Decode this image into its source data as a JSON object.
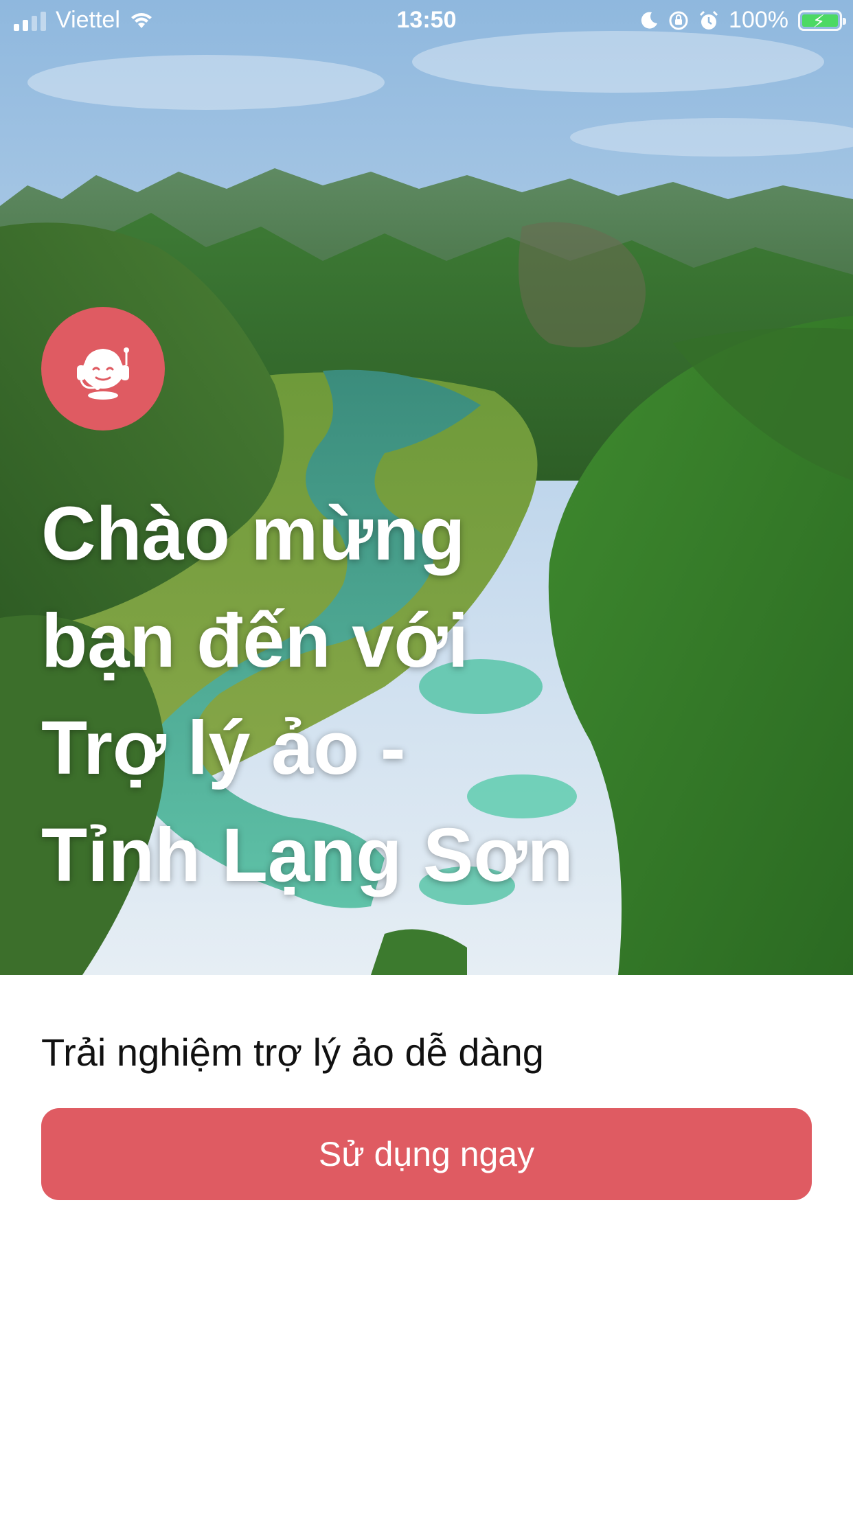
{
  "status_bar": {
    "carrier": "Viettel",
    "time": "13:50",
    "battery_percent": "100%",
    "signal_icon": "cellular-signal-icon",
    "wifi_icon": "wifi-icon",
    "icons": [
      "moon-icon",
      "orientation-lock-icon",
      "alarm-icon",
      "battery-charging-icon"
    ],
    "battery_level": 1.0
  },
  "hero": {
    "bot_icon": "support-bot-icon",
    "title_lines": [
      "Chào mừng",
      "bạn đến với",
      "Trợ lý ảo -",
      "Tỉnh Lạng Sơn"
    ]
  },
  "main": {
    "subtitle": "Trải nghiệm trợ lý ảo dễ dàng",
    "cta_label": "Sử dụng ngay"
  },
  "colors": {
    "accent": "#df5b62",
    "background": "#ffffff",
    "text": "#111111"
  }
}
